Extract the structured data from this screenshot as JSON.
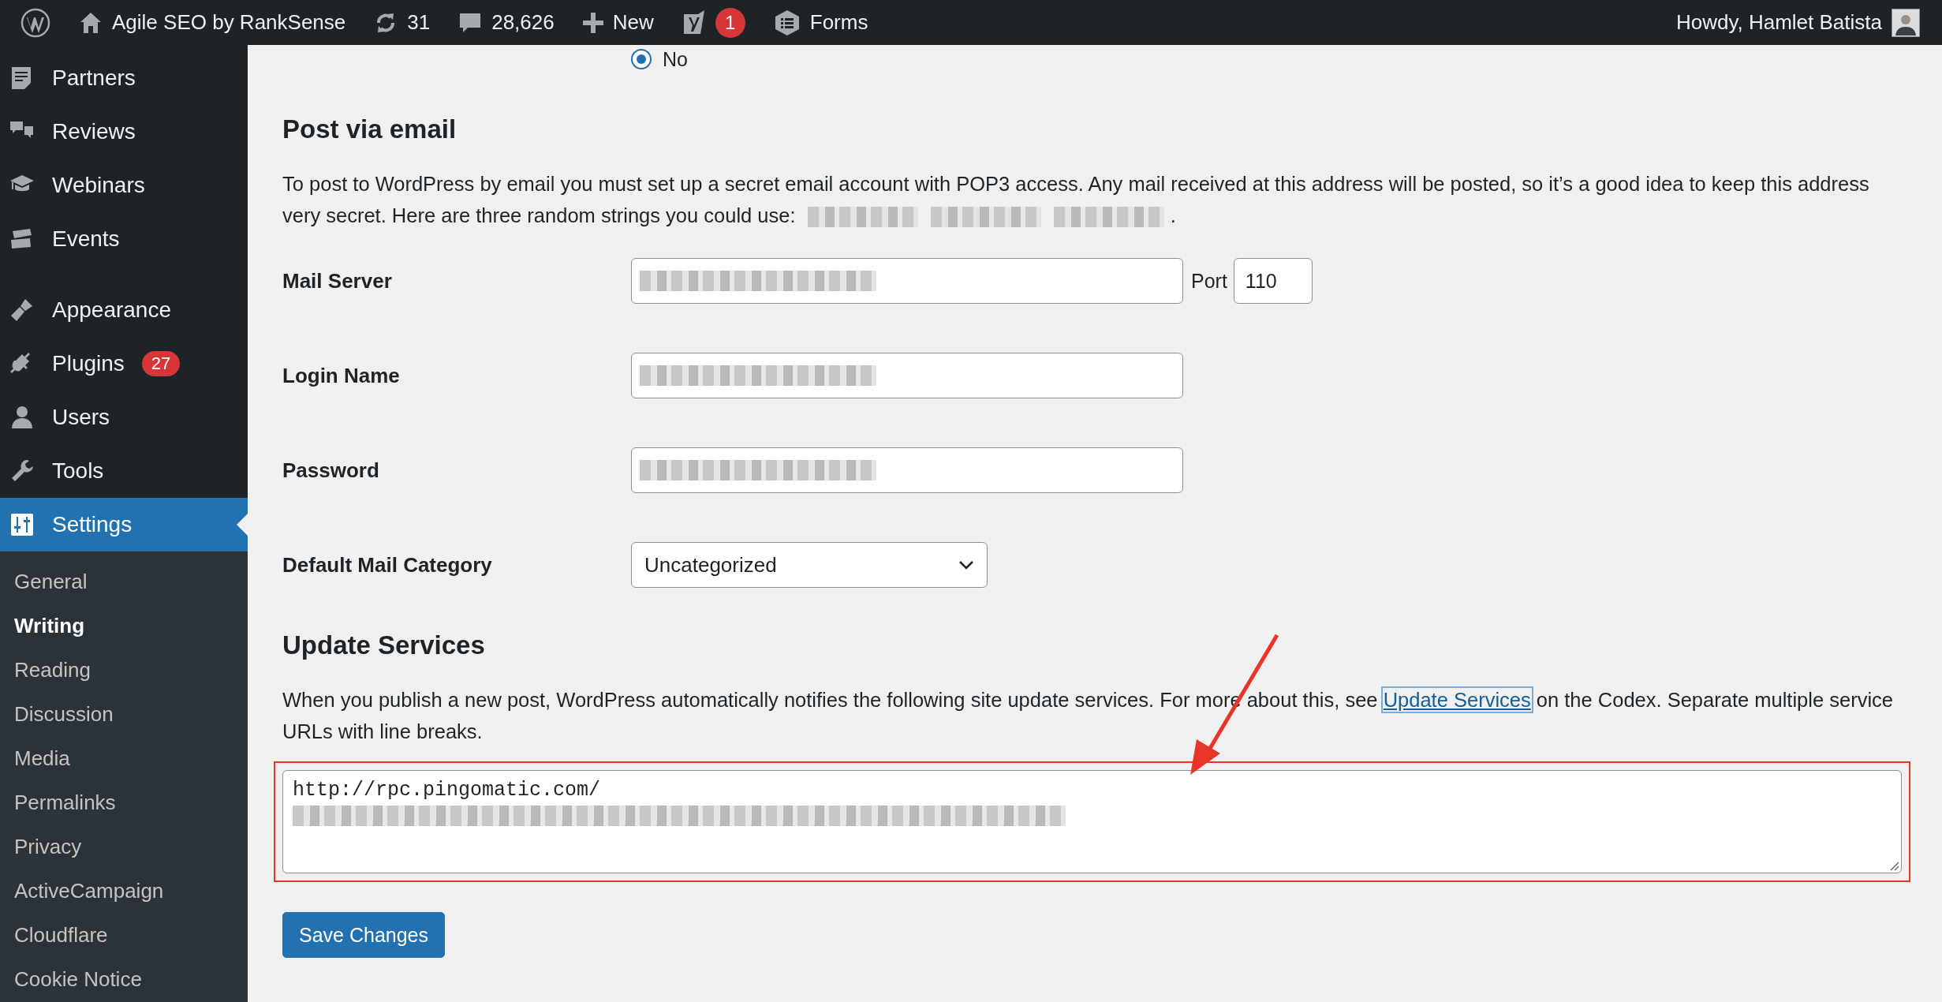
{
  "admin_bar": {
    "site": "Agile SEO by RankSense",
    "updates": "31",
    "comments": "28,626",
    "new": "New",
    "seo_badge": "1",
    "forms": "Forms",
    "greeting": "Howdy, Hamlet Batista"
  },
  "sidebar": {
    "menu_groups": [
      [
        {
          "label": "Partners",
          "selected": false
        },
        {
          "label": "Reviews",
          "selected": false
        },
        {
          "label": "Webinars",
          "selected": false
        },
        {
          "label": "Events",
          "selected": false
        }
      ],
      [
        {
          "label": "Appearance",
          "selected": false
        },
        {
          "label": "Plugins",
          "selected": false,
          "badge": "27"
        },
        {
          "label": "Users",
          "selected": false
        },
        {
          "label": "Tools",
          "selected": false
        },
        {
          "label": "Settings",
          "selected": true
        }
      ]
    ],
    "submenu": [
      {
        "label": "General",
        "selected": false
      },
      {
        "label": "Writing",
        "selected": true
      },
      {
        "label": "Reading",
        "selected": false
      },
      {
        "label": "Discussion",
        "selected": false
      },
      {
        "label": "Media",
        "selected": false
      },
      {
        "label": "Permalinks",
        "selected": false
      },
      {
        "label": "Privacy",
        "selected": false
      },
      {
        "label": "ActiveCampaign",
        "selected": false
      },
      {
        "label": "Cloudflare",
        "selected": false
      },
      {
        "label": "Cookie Notice",
        "selected": false
      }
    ]
  },
  "main": {
    "radio": {
      "label": "No",
      "selected": true
    },
    "post_via_email": {
      "title": "Post via email",
      "description": "To post to WordPress by email you must set up a secret email account with POP3 access. Any mail received at this address will be posted, so it’s a good idea to keep this address very secret. Here are three random strings you could use:",
      "random_strings": [
        {
          "redacted": true
        },
        {
          "redacted": true
        },
        {
          "redacted": true
        }
      ],
      "description_end": ".",
      "rows": [
        {
          "label": "Mail Server",
          "kind": "text",
          "redacted": true,
          "port": {
            "label": "Port",
            "value": "110"
          }
        },
        {
          "label": "Login Name",
          "kind": "text",
          "redacted": true
        },
        {
          "label": "Password",
          "kind": "text",
          "redacted": true
        },
        {
          "label": "Default Mail Category",
          "kind": "select",
          "value": "Uncategorized"
        }
      ]
    },
    "update_services": {
      "title": "Update Services",
      "description_before": "When you publish a new post, WordPress automatically notifies the following site update services. For more about this, see ",
      "link": "Update Services",
      "description_after": " on the Codex. Separate multiple service URLs with line breaks.",
      "services": "http://rpc.pingomatic.com/",
      "redacted": true,
      "highlighted": true
    },
    "save_button": "Save Changes"
  }
}
